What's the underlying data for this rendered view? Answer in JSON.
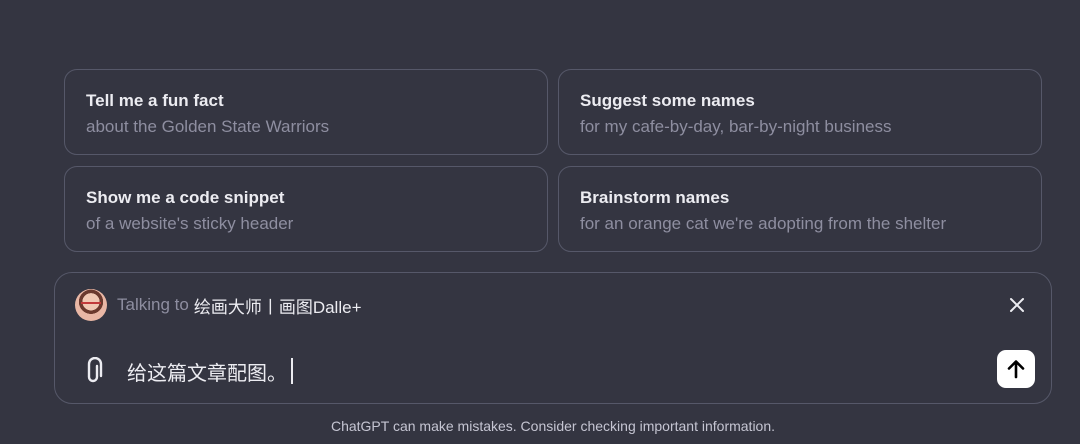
{
  "suggestions": [
    {
      "title": "Tell me a fun fact",
      "subtitle": "about the Golden State Warriors"
    },
    {
      "title": "Suggest some names",
      "subtitle": "for my cafe-by-day, bar-by-night business"
    },
    {
      "title": "Show me a code snippet",
      "subtitle": "of a website's sticky header"
    },
    {
      "title": "Brainstorm names",
      "subtitle": "for an orange cat we're adopting from the shelter"
    }
  ],
  "composer": {
    "talking_to_label": "Talking to",
    "gizmo_name": "绘画大师丨画图Dalle+",
    "input_value": "给这篇文章配图。",
    "avatar_icon": "user-avatar",
    "close_icon": "close-icon",
    "attach_icon": "paperclip-icon",
    "send_icon": "arrow-up-icon"
  },
  "footer": {
    "disclaimer": "ChatGPT can make mistakes. Consider checking important information."
  },
  "colors": {
    "background": "#343541",
    "border": "#565869",
    "text_primary": "#ececf1",
    "text_secondary": "#8e8ea0",
    "send_button": "#ffffff"
  }
}
